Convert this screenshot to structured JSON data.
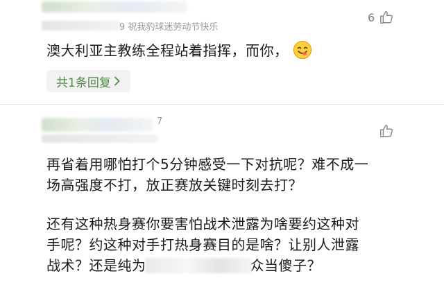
{
  "comment1": {
    "meta_visible": "9 祝我豹球迷劳动节快乐",
    "like_count": "6",
    "text": "澳大利亚主教练全程站着指挥，而你，",
    "emoji": "face-savoring-icon",
    "reply_label": "共1条回复",
    "reply_chevron": "chevron-right-icon"
  },
  "comment2": {
    "meta_visible": "7",
    "paragraph1_line1": "再省着用哪怕打个5分钟感受一下对抗呢？难不成一",
    "paragraph1_line2": "场高强度不打，放正赛放关键时刻去打？",
    "paragraph2_line1": "还有这种热身赛你要害怕战术泄露为啥要约这种对",
    "paragraph2_line2": "手呢？约这种对手打热身赛目的是啥？让别人泄露",
    "paragraph2_line3_start": "战术？还是纯为",
    "paragraph2_line3_end": "众当傻子？"
  },
  "colors": {
    "reply_text": "#4e8a44",
    "reply_bg": "#f2f2f2",
    "meta": "#9a9a9a"
  }
}
